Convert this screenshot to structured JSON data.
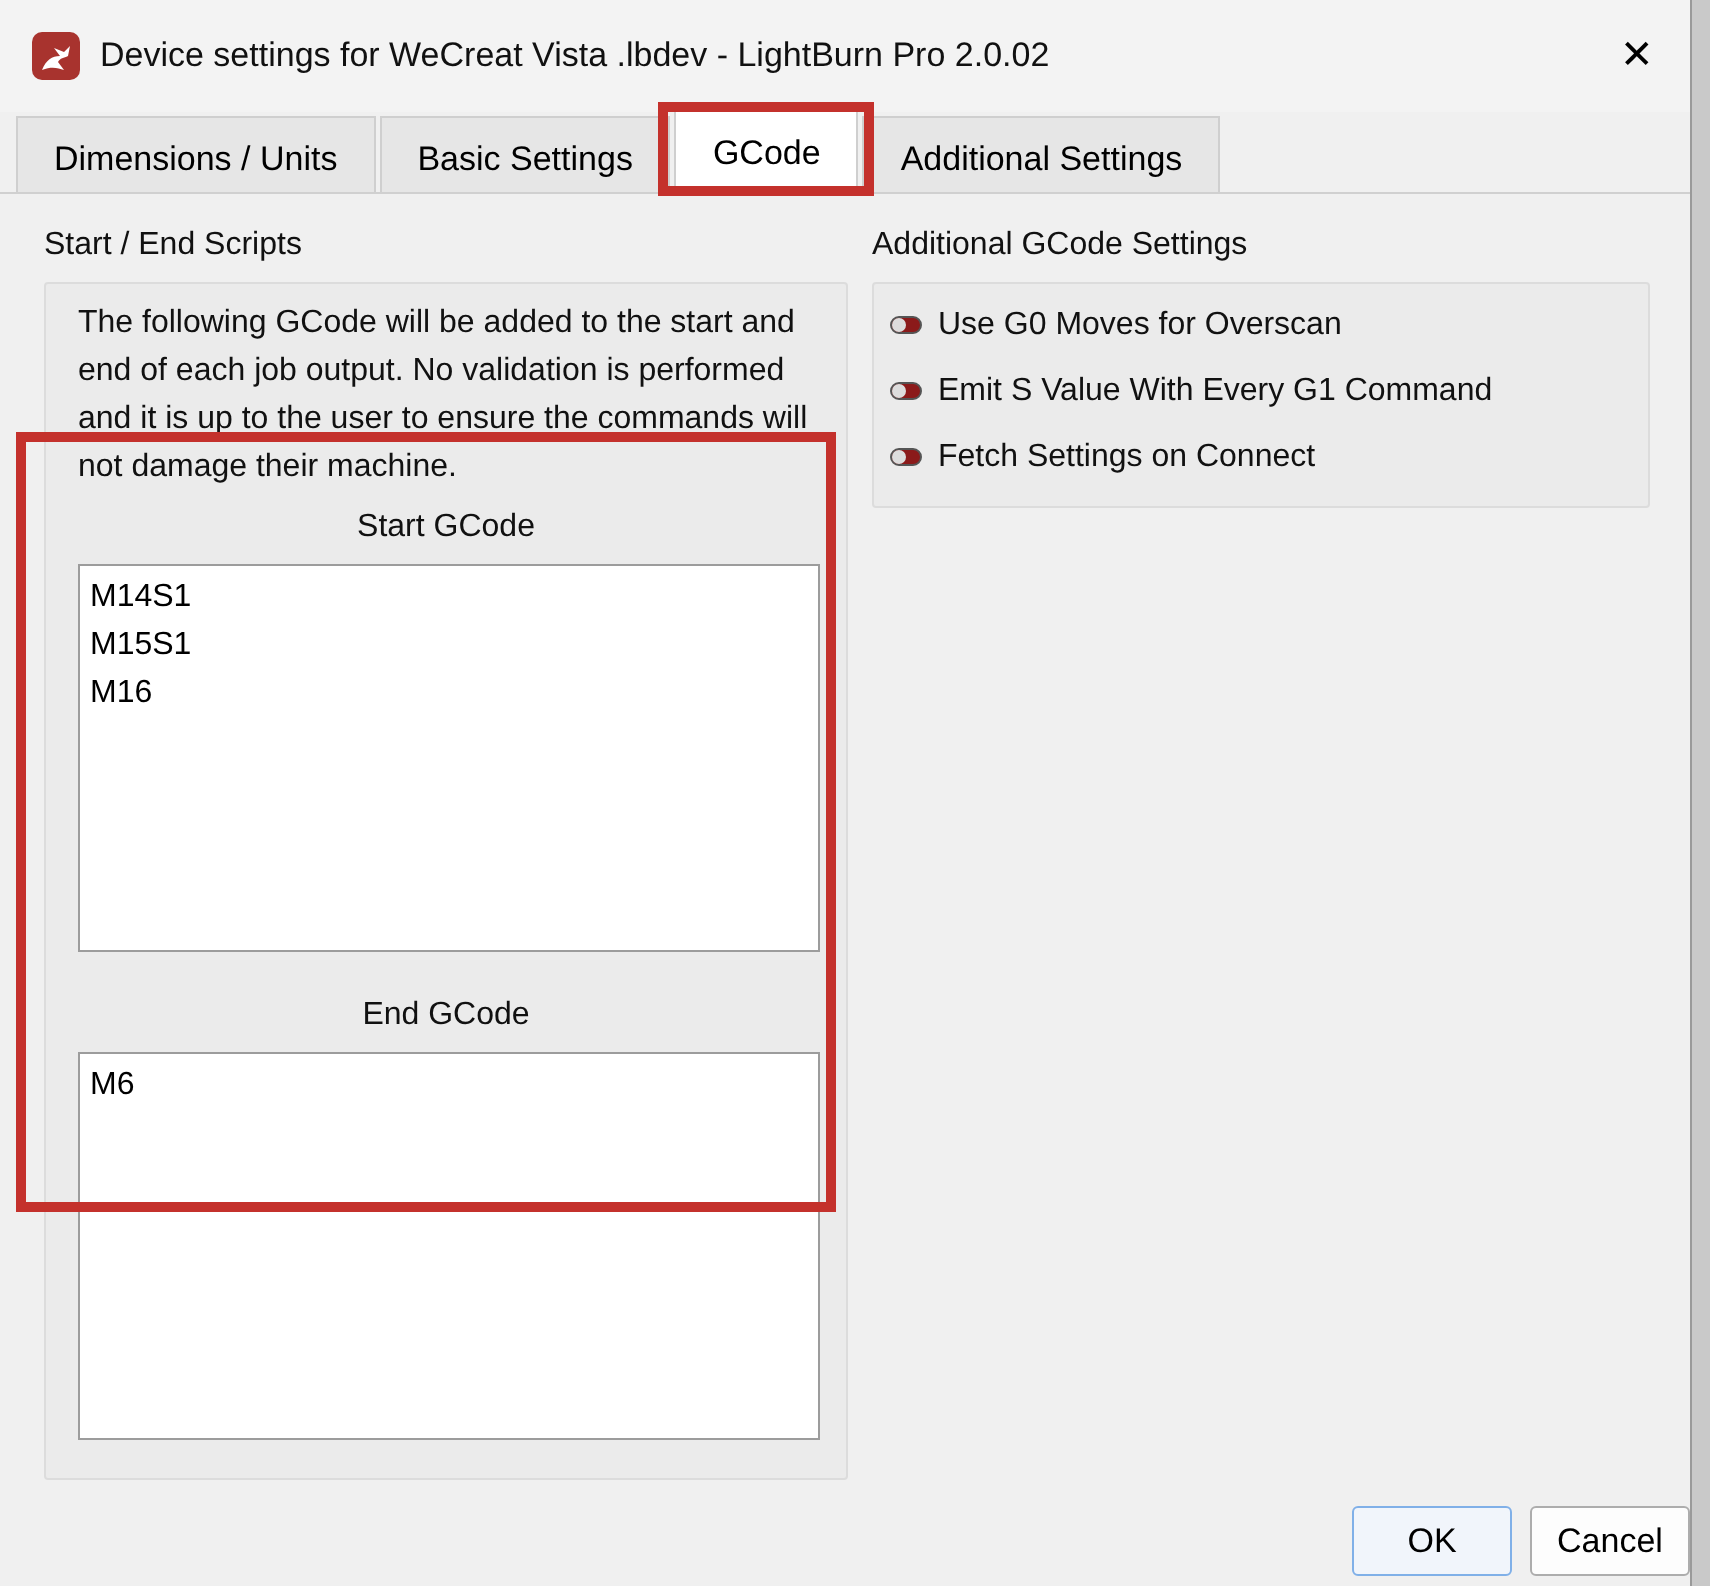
{
  "window": {
    "title": "Device settings for WeCreat Vista .lbdev - LightBurn Pro 2.0.02",
    "close": "✕"
  },
  "tabs": [
    {
      "label": "Dimensions / Units",
      "selected": false,
      "highlighted": false
    },
    {
      "label": "Basic Settings",
      "selected": false,
      "highlighted": false
    },
    {
      "label": "GCode",
      "selected": true,
      "highlighted": true
    },
    {
      "label": "Additional Settings",
      "selected": false,
      "highlighted": false
    }
  ],
  "scripts": {
    "title": "Start / End Scripts",
    "description": "The following GCode will be added to the start and end of each job output. No validation is performed and it is up to the user to ensure the commands will not damage their machine.",
    "highlighted": true,
    "start_label": "Start GCode",
    "start_value": "M14S1\nM15S1\nM16",
    "end_label": "End GCode",
    "end_value": "M6"
  },
  "additional": {
    "title": "Additional GCode Settings",
    "options": [
      {
        "label": "Use G0 Moves for Overscan",
        "on": false
      },
      {
        "label": "Emit S Value With Every G1 Command",
        "on": false
      },
      {
        "label": "Fetch Settings on Connect",
        "on": false
      }
    ]
  },
  "buttons": [
    {
      "label": "OK",
      "default": true
    },
    {
      "label": "Cancel",
      "default": false
    }
  ]
}
